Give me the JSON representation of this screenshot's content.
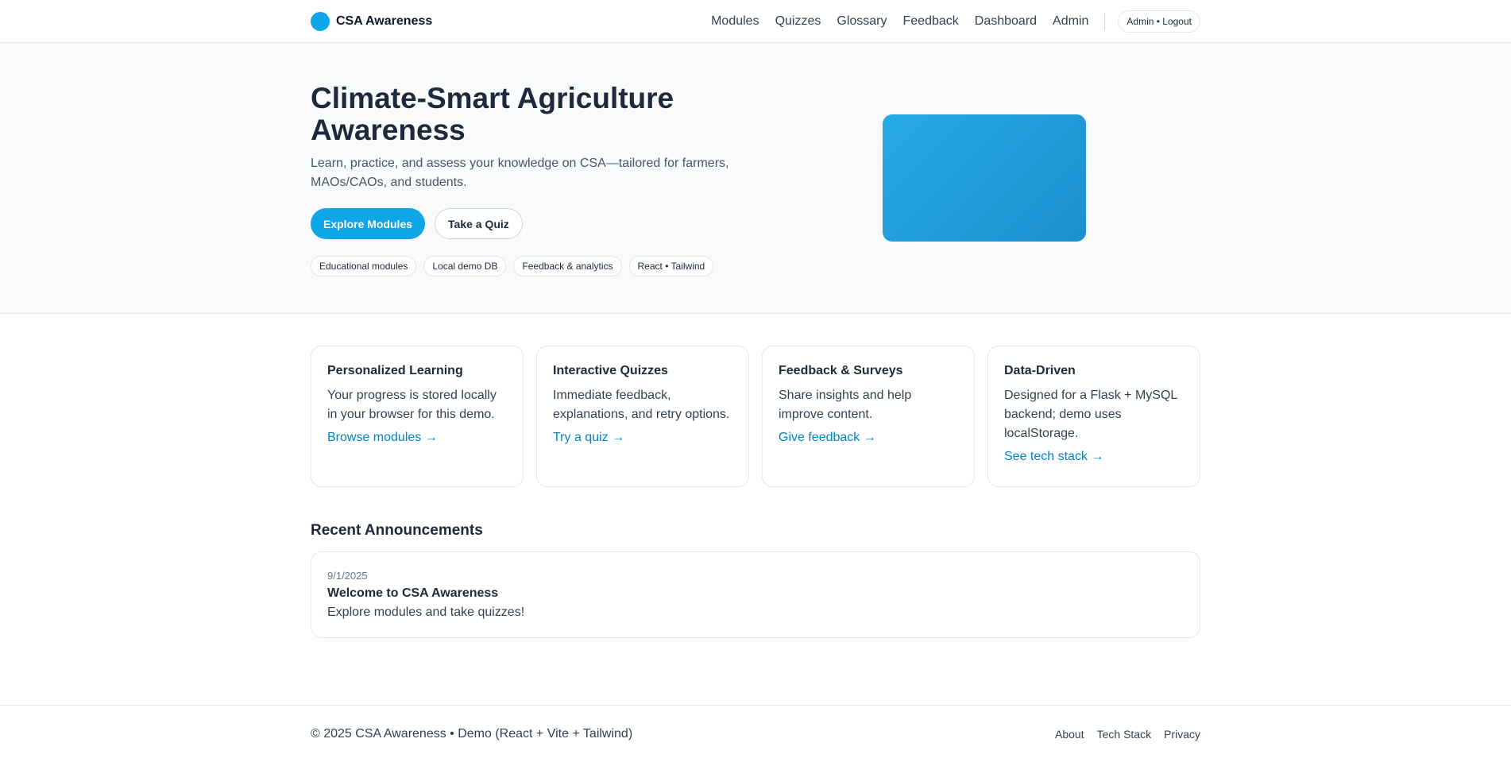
{
  "header": {
    "brand": "CSA Awareness",
    "nav": [
      "Modules",
      "Quizzes",
      "Glossary",
      "Feedback",
      "Dashboard",
      "Admin"
    ],
    "user": "Admin • Logout"
  },
  "hero": {
    "title": "Climate-Smart Agriculture Awareness",
    "subtitle": "Learn, practice, and assess your knowledge on CSA—tailored for farmers, MAOs/CAOs, and students.",
    "primary_button": "Explore Modules",
    "secondary_button": "Take a Quiz",
    "chips": [
      "Educational modules",
      "Local demo DB",
      "Feedback & analytics",
      "React • Tailwind"
    ],
    "art_color": "#1c9bd9"
  },
  "features": [
    {
      "title": "Personalized Learning",
      "text": "Your progress is stored locally in your browser for this demo.",
      "link": "Browse modules →"
    },
    {
      "title": "Interactive Quizzes",
      "text": "Immediate feedback, explanations, and retry options.",
      "link": "Try a quiz →"
    },
    {
      "title": "Feedback & Surveys",
      "text": "Share insights and help improve content.",
      "link": "Give feedback →"
    },
    {
      "title": "Data-Driven",
      "text": "Designed for a Flask + MySQL backend; demo uses localStorage.",
      "link": "See tech stack →"
    }
  ],
  "announcements": {
    "title": "Recent Announcements",
    "items": [
      {
        "date": "9/1/2025",
        "title": "Welcome to CSA Awareness",
        "body": "Explore modules and take quizzes!"
      }
    ]
  },
  "footer": {
    "copyright": "© 2025 CSA Awareness • Demo (React + Vite + Tailwind)",
    "links": [
      "About",
      "Tech Stack",
      "Privacy"
    ]
  },
  "colors": {
    "accent": "#0ea5e9",
    "link": "#0284c7",
    "hero_bg": "#f8fafc"
  }
}
